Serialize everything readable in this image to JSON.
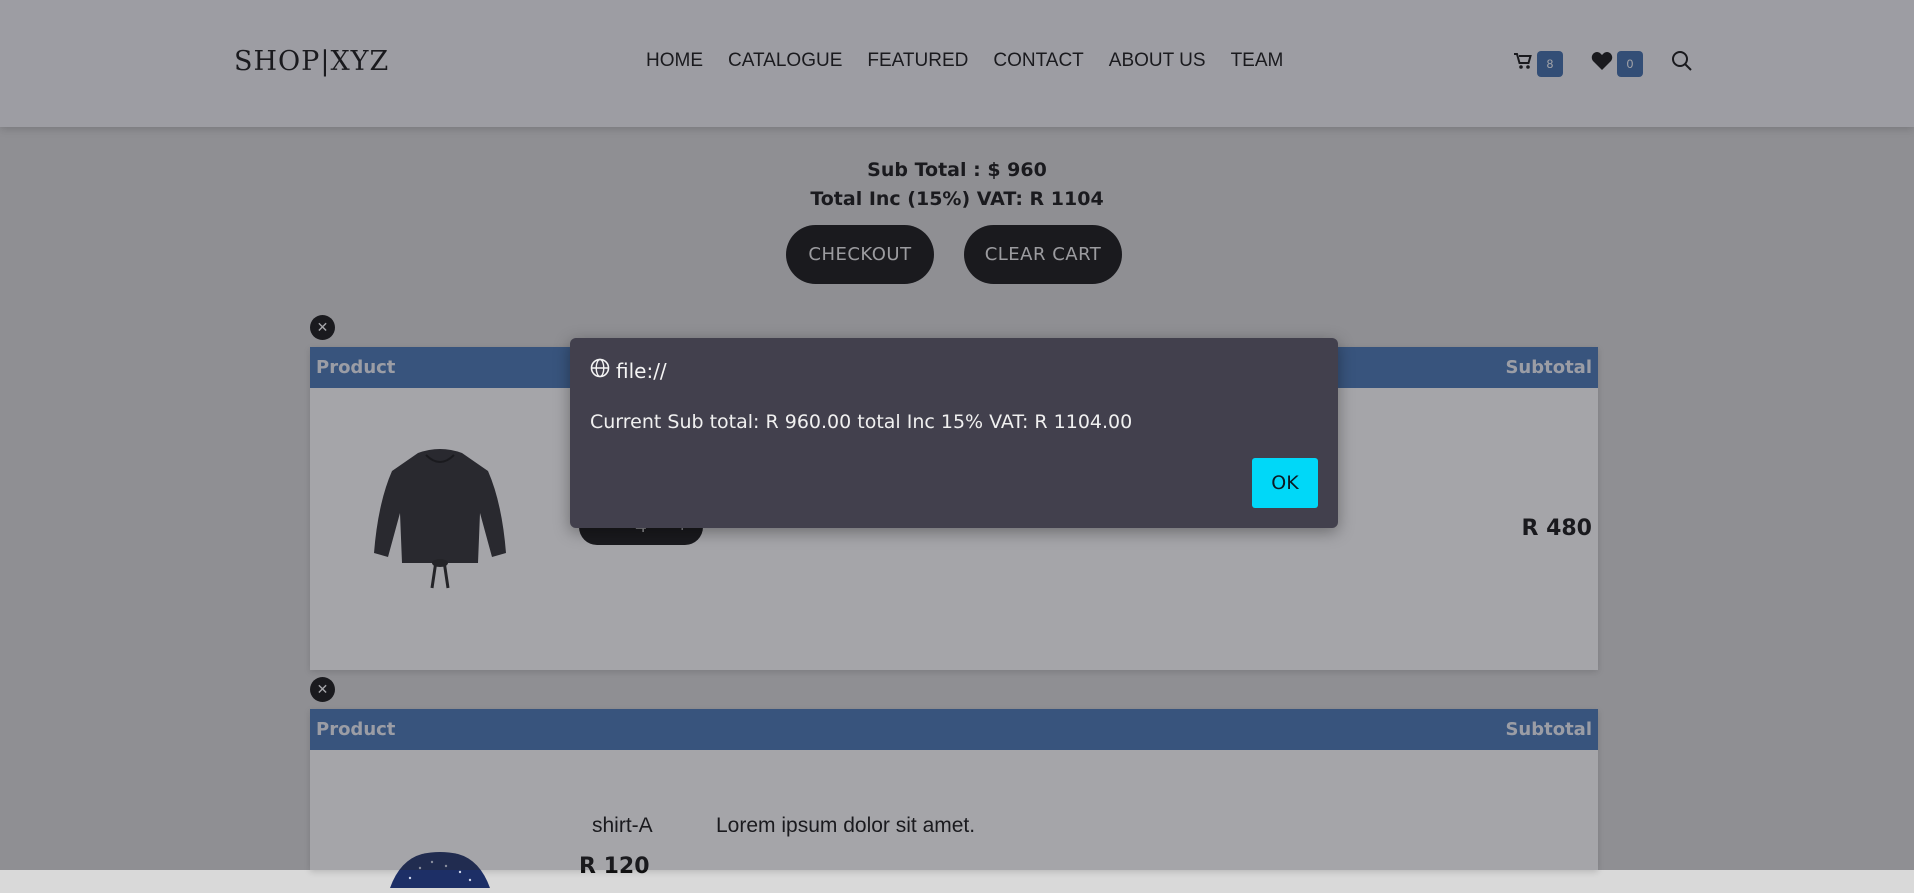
{
  "header": {
    "logo": "SHOP|XYZ",
    "nav": [
      "HOME",
      "CATALOGUE",
      "FEATURED",
      "CONTACT",
      "ABOUT US",
      "TEAM"
    ],
    "cart_count": "8",
    "wishlist_count": "0"
  },
  "summary": {
    "subtotal": "Sub Total : $ 960",
    "total_vat": "Total Inc (15%) VAT: R 1104",
    "checkout_label": "CHECKOUT",
    "clear_label": "CLEAR CART"
  },
  "cart": {
    "items": [
      {
        "col_product": "Product",
        "col_subtotal": "Subtotal",
        "quantity": "4",
        "subtotal": "R 480"
      },
      {
        "col_product": "Product",
        "col_subtotal": "Subtotal",
        "name": "shirt-A",
        "description": "Lorem ipsum dolor sit amet.",
        "price": "R 120"
      }
    ]
  },
  "dialog": {
    "origin": "file://",
    "message": "Current Sub total: R 960.00 total Inc 15% VAT: R 1104.00",
    "ok_label": "OK"
  },
  "colors": {
    "accent": "#00d8f8",
    "header_blue": "#4474b4",
    "dialog_bg": "#42404d"
  }
}
